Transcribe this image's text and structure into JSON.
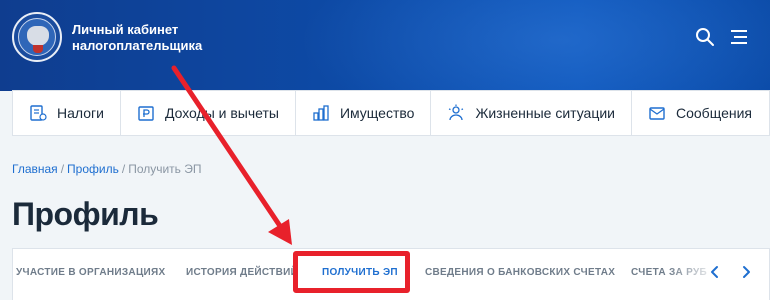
{
  "header": {
    "brand_line1": "Личный кабинет",
    "brand_line2": "налогоплательщика",
    "icons": [
      "emblem-icon",
      "search-icon",
      "menu-icon"
    ]
  },
  "nav": {
    "items": [
      {
        "label": "Налоги",
        "icon": "tax-icon"
      },
      {
        "label": "Доходы и вычеты",
        "icon": "income-icon"
      },
      {
        "label": "Имущество",
        "icon": "property-icon"
      },
      {
        "label": "Жизненные ситуации",
        "icon": "life-situations-icon"
      },
      {
        "label": "Сообщения",
        "icon": "messages-icon"
      }
    ]
  },
  "breadcrumb": {
    "home": "Главная",
    "profile": "Профиль",
    "current": "Получить ЭП",
    "separator": "/"
  },
  "page": {
    "title": "Профиль"
  },
  "tabs": {
    "items": [
      {
        "label": "УЧАСТИЕ В ОРГАНИЗАЦИЯХ",
        "active": false
      },
      {
        "label": "ИСТОРИЯ ДЕЙСТВИЙ",
        "active": false
      },
      {
        "label": "ПОЛУЧИТЬ ЭП",
        "active": true
      },
      {
        "label": "СВЕДЕНИЯ О БАНКОВСКИХ СЧЕТАХ",
        "active": false
      },
      {
        "label": "СЧЕТА ЗА РУБ",
        "active": false
      }
    ]
  },
  "colors": {
    "header_blue": "#0d4aa6",
    "accent": "#1f6fd0",
    "annotation_red": "#e8212b"
  }
}
